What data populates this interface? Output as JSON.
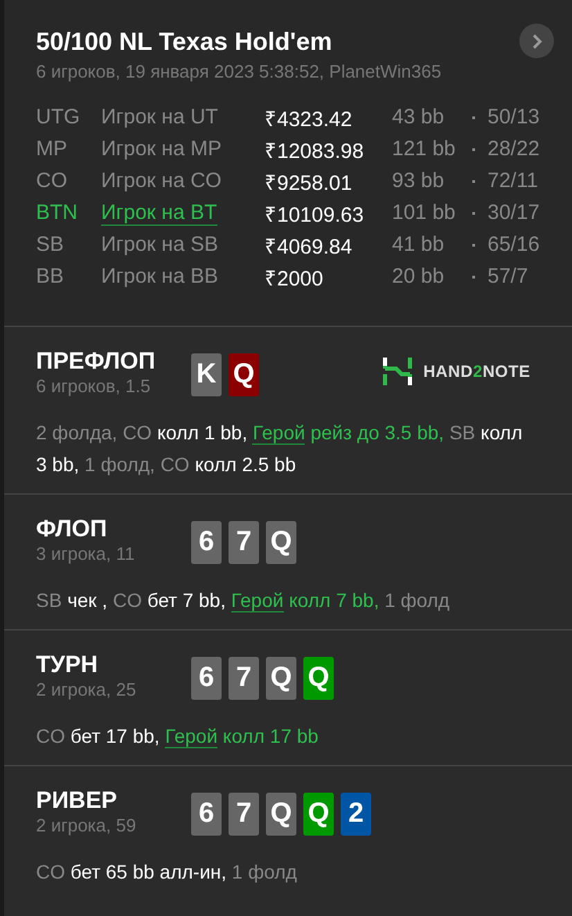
{
  "hand": {
    "title": "50/100 NL Texas Hold'em",
    "subtitle": "6 игроков, 19 января 2023 5:38:52, PlanetWin365",
    "players": [
      {
        "position": "UTG",
        "name": "Игрок на UT",
        "stack": "₹4323.42",
        "bb": "43 bb",
        "stats": "50/13",
        "hero": false
      },
      {
        "position": "MP",
        "name": "Игрок на MP",
        "stack": "₹12083.98",
        "bb": "121 bb",
        "stats": "28/22",
        "hero": false
      },
      {
        "position": "CO",
        "name": "Игрок на CO",
        "stack": "₹9258.01",
        "bb": "93 bb",
        "stats": "72/11",
        "hero": false
      },
      {
        "position": "BTN",
        "name": "Игрок на BT",
        "stack": "₹10109.63",
        "bb": "101 bb",
        "stats": "30/17",
        "hero": true
      },
      {
        "position": "SB",
        "name": "Игрок на SB",
        "stack": "₹4069.84",
        "bb": "41 bb",
        "stats": "65/16",
        "hero": false
      },
      {
        "position": "BB",
        "name": "Игрок на BB",
        "stack": "₹2000",
        "bb": "20 bb",
        "stats": "57/7",
        "hero": false
      }
    ]
  },
  "streets": [
    {
      "name": "ПРЕФЛОП",
      "info": "6 игроков, 1.5",
      "logo": [
        {
          "text": "HAND",
          "accent": false
        },
        {
          "text": "2",
          "accent": true
        },
        {
          "text": "NOTE",
          "accent": false
        }
      ],
      "cards": [
        {
          "rank": "K",
          "color": "#666666"
        },
        {
          "rank": "Q",
          "color": "#8b0000"
        }
      ],
      "actions": [
        {
          "kind": "muted",
          "text": "2 фолда, CO "
        },
        {
          "kind": "action",
          "text": "колл 1 bb, "
        },
        {
          "kind": "hero_link",
          "text": "Герой"
        },
        {
          "kind": "hero",
          "text": " рейз до 3.5 bb, "
        },
        {
          "kind": "muted",
          "text": "SB "
        },
        {
          "kind": "action",
          "text": "колл 3 bb, "
        },
        {
          "kind": "muted",
          "text": "1 фолд, CO "
        },
        {
          "kind": "action",
          "text": "колл 2.5 bb"
        }
      ]
    },
    {
      "name": "ФЛОП",
      "info": "3 игрока, 11",
      "cards": [
        {
          "rank": "6",
          "color": "#666666"
        },
        {
          "rank": "7",
          "color": "#666666"
        },
        {
          "rank": "Q",
          "color": "#666666"
        }
      ],
      "actions": [
        {
          "kind": "muted",
          "text": "SB "
        },
        {
          "kind": "action",
          "text": "чек , "
        },
        {
          "kind": "muted",
          "text": "CO "
        },
        {
          "kind": "action",
          "text": "бет 7 bb, "
        },
        {
          "kind": "hero_link",
          "text": "Герой"
        },
        {
          "kind": "hero",
          "text": " колл 7 bb, "
        },
        {
          "kind": "muted",
          "text": "1 фолд"
        }
      ]
    },
    {
      "name": "ТУРН",
      "info": "2 игрока, 25",
      "cards": [
        {
          "rank": "6",
          "color": "#666666"
        },
        {
          "rank": "7",
          "color": "#666666"
        },
        {
          "rank": "Q",
          "color": "#666666"
        },
        {
          "rank": "Q",
          "color": "#009900"
        }
      ],
      "actions": [
        {
          "kind": "muted",
          "text": "CO "
        },
        {
          "kind": "action",
          "text": "бет 17 bb, "
        },
        {
          "kind": "hero_link",
          "text": "Герой"
        },
        {
          "kind": "hero",
          "text": " колл 17 bb"
        }
      ]
    },
    {
      "name": "РИВЕР",
      "info": "2 игрока, 59",
      "cards": [
        {
          "rank": "6",
          "color": "#666666"
        },
        {
          "rank": "7",
          "color": "#666666"
        },
        {
          "rank": "Q",
          "color": "#666666"
        },
        {
          "rank": "Q",
          "color": "#009900"
        },
        {
          "rank": "2",
          "color": "#0055a5"
        }
      ],
      "actions": [
        {
          "kind": "muted",
          "text": "CO "
        },
        {
          "kind": "action",
          "text": "бет 65 bb алл-ин, "
        },
        {
          "kind": "muted",
          "text": "1 фолд"
        }
      ]
    }
  ]
}
